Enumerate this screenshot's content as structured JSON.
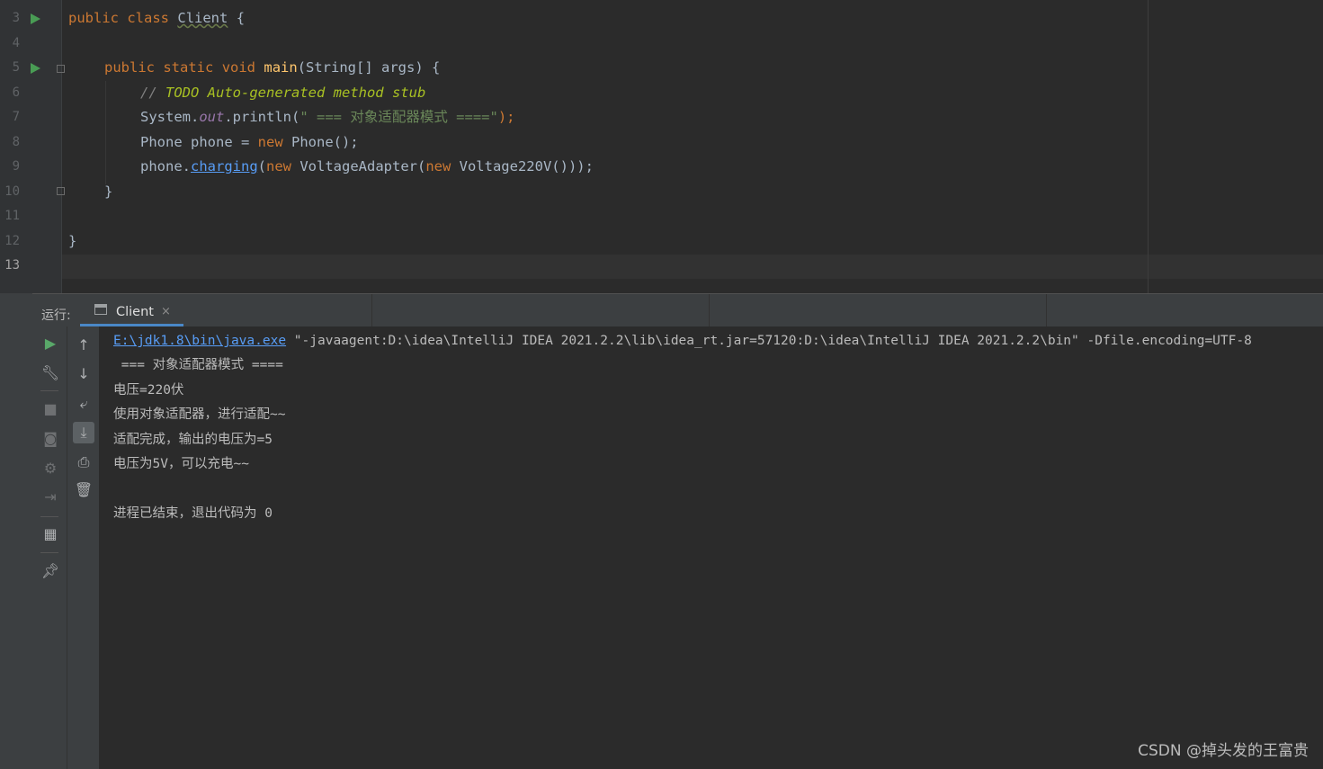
{
  "editor": {
    "line_numbers": [
      "3",
      "4",
      "5",
      "6",
      "7",
      "8",
      "9",
      "10",
      "11",
      "12",
      "13"
    ],
    "current_line": "13",
    "code": {
      "l3": {
        "kw1": "public",
        "kw2": "class",
        "cls": "Client",
        "brace": "{"
      },
      "l5": {
        "kw1": "public",
        "kw2": "static",
        "kw3": "void",
        "fn": "main",
        "args": "(String[] args) {"
      },
      "l6": {
        "prefix": "// ",
        "todo": "TODO Auto-generated method stub"
      },
      "l7": {
        "a": "System.",
        "fld": "out",
        "b": ".println(",
        "str": "\" === 对象适配器模式 ====\"",
        "c": ");"
      },
      "l8": {
        "a": "Phone phone = ",
        "kw": "new",
        "b": " Phone();"
      },
      "l9": {
        "a": "phone.",
        "lnk": "charging",
        "b": "(",
        "kw1": "new",
        "c": " VoltageAdapter(",
        "kw2": "new",
        "d": " Voltage220V()));"
      },
      "l10": {
        "brace": "}"
      },
      "l12": {
        "brace": "}"
      }
    }
  },
  "run_panel": {
    "label": "运行:",
    "tab_title": "Client",
    "tab_close": "×",
    "output": {
      "cmd_link": "E:\\jdk1.8\\bin\\java.exe",
      "cmd_rest": " \"-javaagent:D:\\idea\\IntelliJ IDEA 2021.2.2\\lib\\idea_rt.jar=57120:D:\\idea\\IntelliJ IDEA 2021.2.2\\bin\" -Dfile.encoding=UTF-8",
      "lines": [
        " === 对象适配器模式 ====",
        "电压=220伏",
        "使用对象适配器，进行适配~~",
        "适配完成，输出的电压为=5",
        "电压为5V，可以充电~~",
        "",
        "进程已结束，退出代码为 0"
      ]
    }
  },
  "watermark": "CSDN @掉头发的王富贵",
  "icons": {
    "run": "play-icon",
    "wrench": "wrench-icon",
    "stop": "stop-icon",
    "camera": "camera-icon",
    "debug": "gear-icon",
    "login": "login-icon",
    "layout": "layout-icon",
    "pin": "pin-icon",
    "up": "arrow-up-icon",
    "down": "arrow-down-icon",
    "wrap": "soft-wrap-icon",
    "scroll": "scroll-to-end-icon",
    "print": "print-icon",
    "trash": "trash-icon"
  }
}
